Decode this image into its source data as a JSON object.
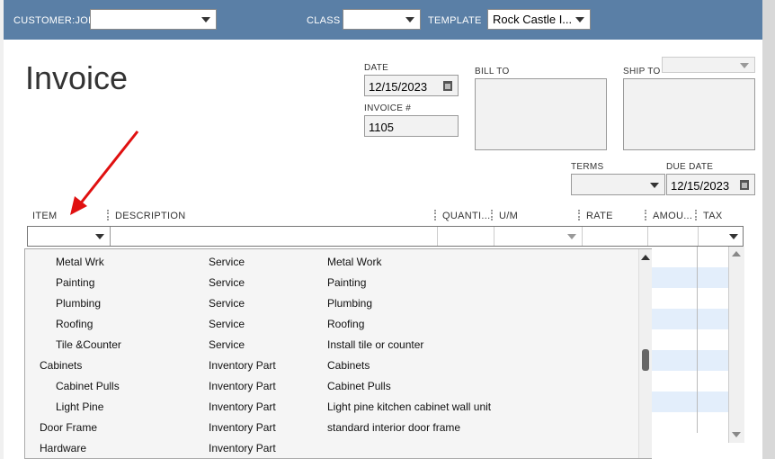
{
  "header": {
    "customer_job_label": "CUSTOMER:JOB",
    "customer_job_value": "",
    "class_label": "CLASS",
    "class_value": "",
    "template_label": "TEMPLATE",
    "template_value": "Rock Castle I..."
  },
  "form": {
    "title": "Invoice",
    "date_label": "DATE",
    "date_value": "12/15/2023",
    "invoice_no_label": "INVOICE #",
    "invoice_no_value": "1105",
    "bill_to_label": "BILL TO",
    "ship_to_label": "SHIP TO",
    "terms_label": "TERMS",
    "terms_value": "",
    "due_date_label": "DUE DATE",
    "due_date_value": "12/15/2023"
  },
  "columns": [
    "ITEM",
    "DESCRIPTION",
    "QUANTI...",
    "U/M",
    "RATE",
    "AMOU...",
    "TAX"
  ],
  "item_dropdown": {
    "rows": [
      {
        "item": "Metal Wrk",
        "type": "Service",
        "description": "Metal Work",
        "indent": true
      },
      {
        "item": "Painting",
        "type": "Service",
        "description": "Painting",
        "indent": true
      },
      {
        "item": "Plumbing",
        "type": "Service",
        "description": "Plumbing",
        "indent": true
      },
      {
        "item": "Roofing",
        "type": "Service",
        "description": "Roofing",
        "indent": true
      },
      {
        "item": "Tile &Counter",
        "type": "Service",
        "description": "Install tile or counter",
        "indent": true
      },
      {
        "item": "Cabinets",
        "type": "Inventory Part",
        "description": "Cabinets",
        "indent": false
      },
      {
        "item": "Cabinet Pulls",
        "type": "Inventory Part",
        "description": "Cabinet Pulls",
        "indent": true
      },
      {
        "item": "Light Pine",
        "type": "Inventory Part",
        "description": "Light pine kitchen cabinet wall unit",
        "indent": true
      },
      {
        "item": "Door Frame",
        "type": "Inventory Part",
        "description": "standard interior door frame",
        "indent": false
      },
      {
        "item": "Hardware",
        "type": "Inventory Part",
        "description": "",
        "indent": false
      }
    ]
  },
  "colors": {
    "header_bar": "#5a7fa6",
    "annotation_arrow": "#e01010",
    "grid_row_alt": "#e3eefb"
  }
}
